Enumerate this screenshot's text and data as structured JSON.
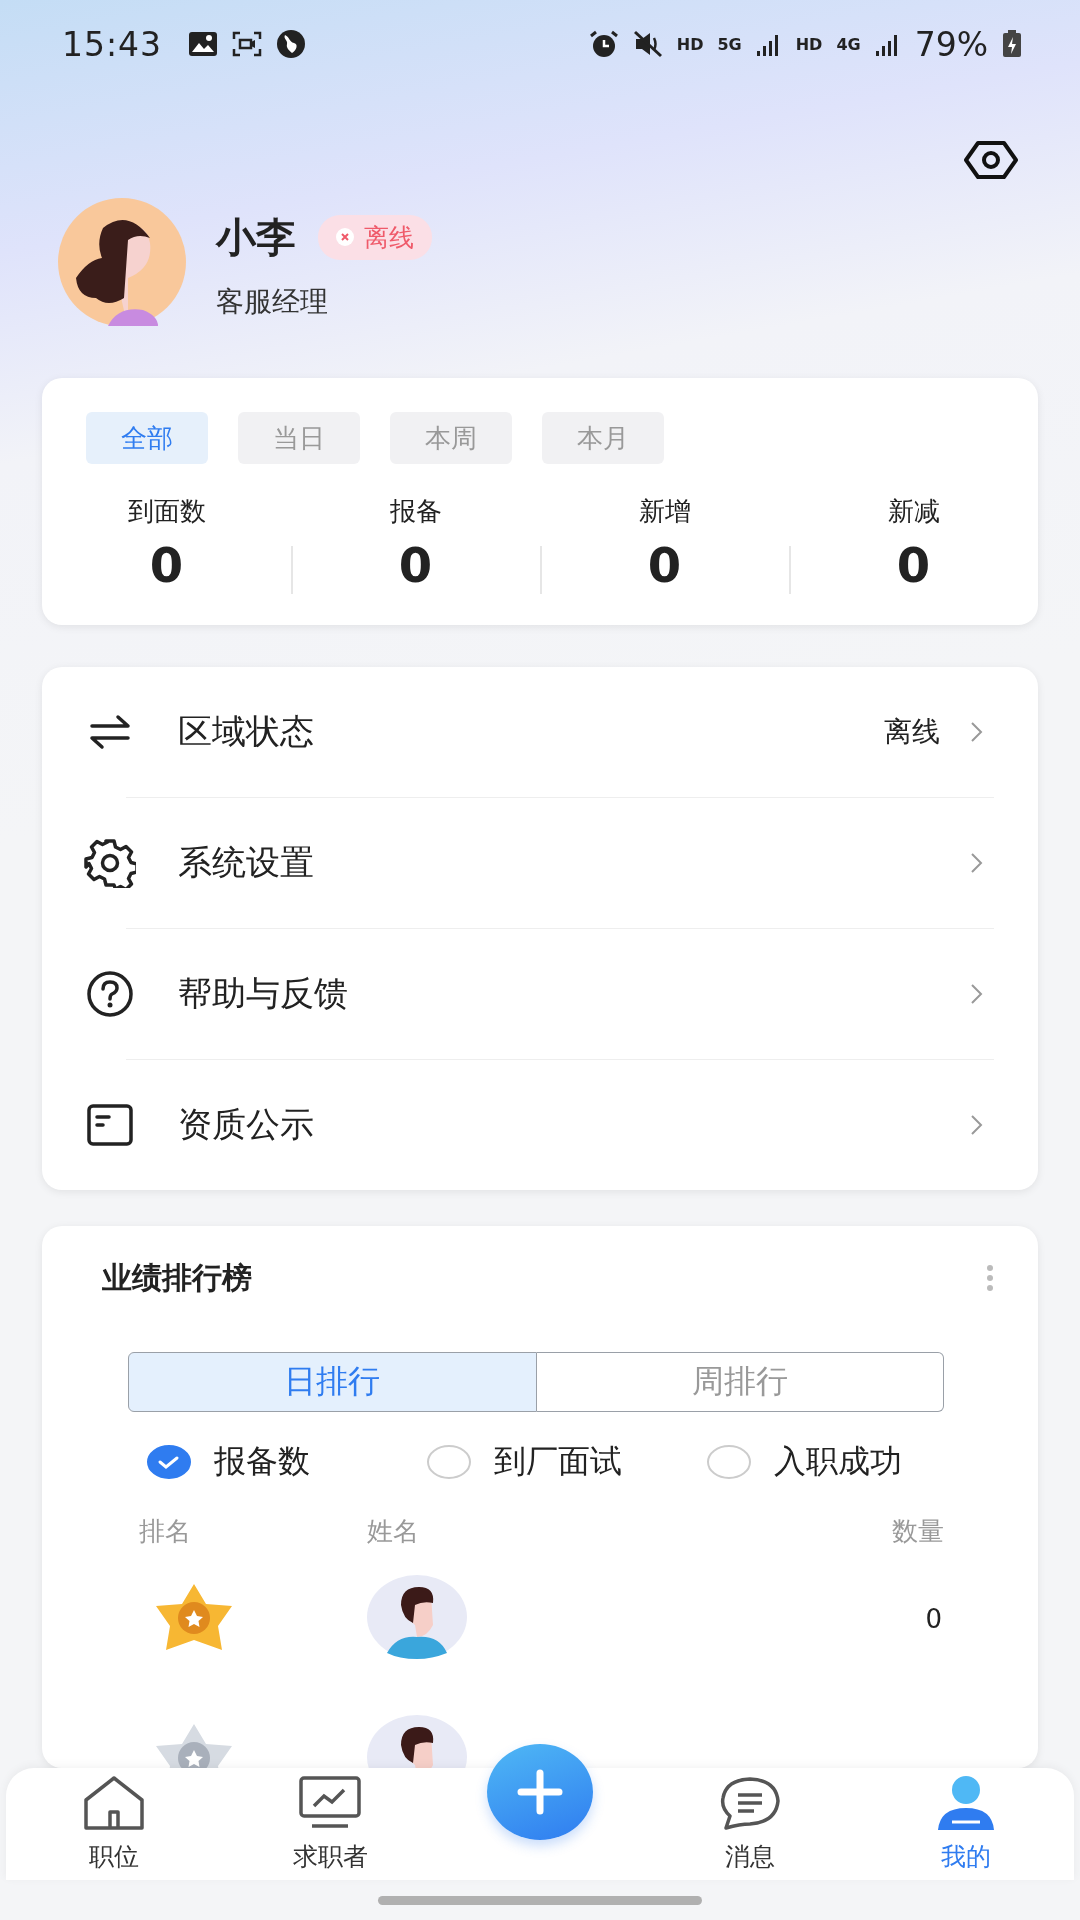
{
  "status_bar": {
    "time": "15:43",
    "network": [
      "HD",
      "5G",
      "HD",
      "4G"
    ],
    "battery": "79%"
  },
  "profile": {
    "name": "小李",
    "status": "离线",
    "online": false,
    "role": "客服经理"
  },
  "period_tabs": [
    {
      "label": "全部",
      "selected": true
    },
    {
      "label": "当日",
      "selected": false
    },
    {
      "label": "本周",
      "selected": false
    },
    {
      "label": "本月",
      "selected": false
    }
  ],
  "stats": [
    {
      "label": "到面数",
      "value": "0"
    },
    {
      "label": "报备",
      "value": "0"
    },
    {
      "label": "新增",
      "value": "0"
    },
    {
      "label": "新减",
      "value": "0"
    }
  ],
  "menu": [
    {
      "kind": "swap",
      "label": "区域状态",
      "value": "离线"
    },
    {
      "kind": "gear",
      "label": "系统设置"
    },
    {
      "kind": "help",
      "label": "帮助与反馈"
    },
    {
      "kind": "doc",
      "label": "资质公示"
    }
  ],
  "ranking": {
    "title": "业绩排行榜",
    "tabs": [
      {
        "label": "日排行",
        "selected": true
      },
      {
        "label": "周排行",
        "selected": false
      }
    ],
    "filters": [
      {
        "label": "报备数",
        "selected": true
      },
      {
        "label": "到厂面试",
        "selected": false
      },
      {
        "label": "入职成功",
        "selected": false
      }
    ],
    "columns": [
      "排名",
      "姓名",
      "数量"
    ],
    "rows": [
      {
        "kind": "gold",
        "value": "0"
      },
      {
        "kind": "silver"
      }
    ]
  },
  "bottom_nav": [
    {
      "kind": "home",
      "label": "职位",
      "selected": false
    },
    {
      "kind": "chart",
      "label": "求职者",
      "selected": false
    },
    {
      "kind": "add"
    },
    {
      "kind": "chat",
      "label": "消息",
      "selected": false
    },
    {
      "kind": "person",
      "label": "我的",
      "selected": true
    }
  ]
}
